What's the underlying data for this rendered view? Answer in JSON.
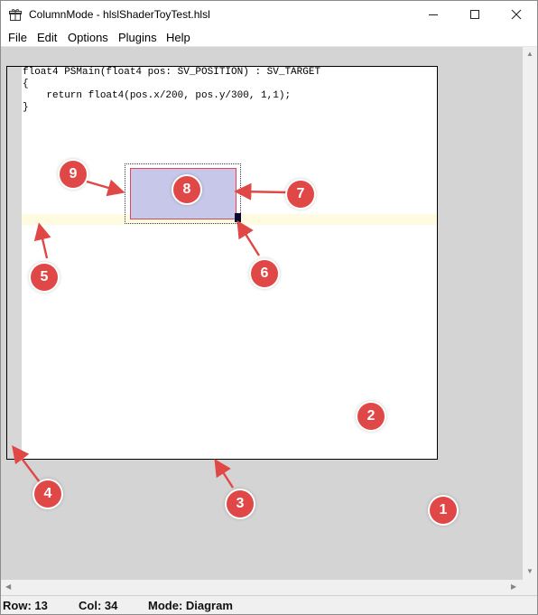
{
  "window": {
    "title": "ColumnMode - hlslShaderToyTest.hlsl",
    "app_icon": "gift-box-icon",
    "controls": [
      "minimize-icon",
      "maximize-icon",
      "close-icon"
    ]
  },
  "menu": {
    "items": [
      "File",
      "Edit",
      "Options",
      "Plugins",
      "Help"
    ]
  },
  "editor": {
    "code_lines": [
      "float4 PSMain(float4 pos: SV_POSITION) : SV_TARGET",
      "{",
      "    return float4(pos.x/200, pos.y/300, 1,1);",
      "}"
    ]
  },
  "annotations": {
    "labels": [
      "1",
      "2",
      "3",
      "4",
      "5",
      "6",
      "7",
      "8",
      "9"
    ],
    "color": "#e04848"
  },
  "status": {
    "row": "Row: 13",
    "col": "Col: 34",
    "mode": "Mode: Diagram"
  },
  "colors": {
    "selection_fill": "#c7c8e9",
    "selection_border": "#d9485c",
    "current_line": "#fffbe0",
    "workspace": "#d4d4d4"
  }
}
